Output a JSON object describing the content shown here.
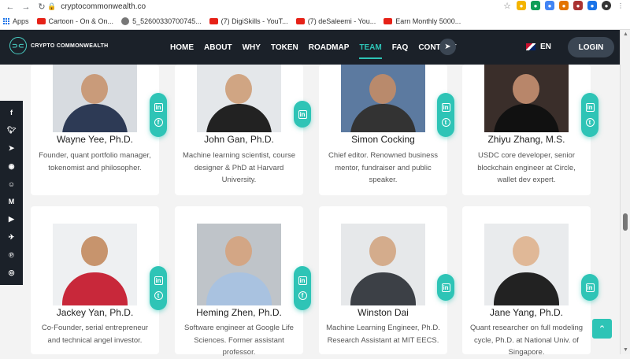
{
  "browser": {
    "url": "cryptocommonwealth.co",
    "bookmarks": [
      "Apps",
      "Cartoon - On & On...",
      "5_52600330700745...",
      "(7) DigiSkills - YouT...",
      "(7) deSaleemi - You...",
      "Earn Monthly 5000..."
    ]
  },
  "nav": {
    "logo_text": "CRYPTO COMMONWEALTH",
    "items": [
      "HOME",
      "ABOUT",
      "WHY",
      "TOKEN",
      "ROADMAP",
      "TEAM",
      "FAQ",
      "CONTACT"
    ],
    "active": "TEAM",
    "language": "EN",
    "login_label": "LOGIN"
  },
  "social_sidebar": [
    "f",
    "t",
    "tg",
    "gh",
    "rd",
    "M",
    "yt",
    "tg2",
    "P",
    "ig"
  ],
  "team": [
    {
      "name": "Wayne Yee, Ph.D.",
      "bio": "Founder, quant portfolio manager, tokenomist and philosopher.",
      "links": [
        "in",
        "f"
      ]
    },
    {
      "name": "John Gan, Ph.D.",
      "bio": "Machine learning scientist, course designer & PhD at Harvard University.",
      "links": [
        "in"
      ]
    },
    {
      "name": "Simon Cocking",
      "bio": "Chief editor. Renowned business mentor, fundraiser and public speaker.",
      "links": [
        "in",
        "t"
      ]
    },
    {
      "name": "Zhiyu Zhang, M.S.",
      "bio": "USDC core developer, senior blockchain engineer at Circle, wallet dev expert.",
      "links": [
        "in",
        "t"
      ]
    },
    {
      "name": "Jackey Yan, Ph.D.",
      "bio": "Co-Founder, serial entrepreneur and technical angel investor.",
      "links": [
        "in",
        "t"
      ]
    },
    {
      "name": "Heming Zhen, Ph.D.",
      "bio": "Software engineer at Google Life Sciences. Former assistant professor.",
      "links": [
        "in",
        "f"
      ]
    },
    {
      "name": "Winston Dai",
      "bio": "Machine Learning Engineer, Ph.D. Research Assistant at MIT EECS.",
      "links": [
        "in"
      ]
    },
    {
      "name": "Jane Yang, Ph.D.",
      "bio": "Quant researcher on full modeling cycle, Ph.D. at National Univ. of Singapore.",
      "links": [
        "in"
      ]
    }
  ],
  "colors": {
    "accent": "#2ec4b6",
    "nav_bg": "#1b2129"
  }
}
